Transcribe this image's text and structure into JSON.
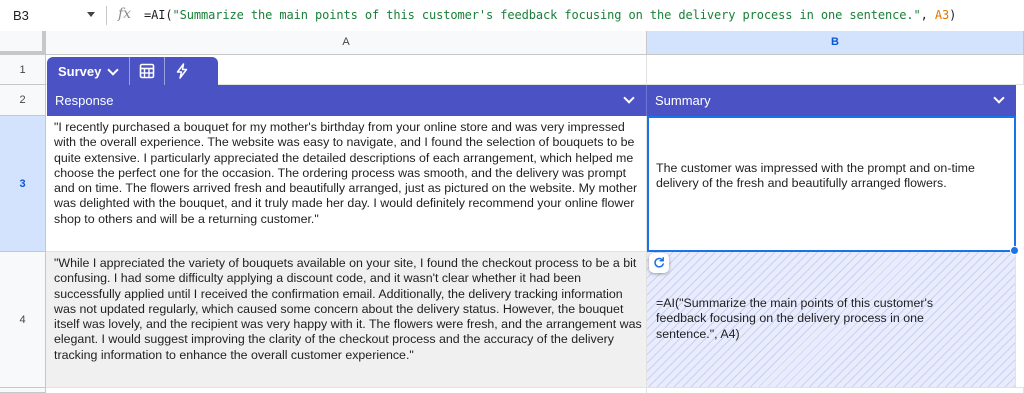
{
  "formula_bar": {
    "name_box": "B3",
    "fx_label": "fx",
    "formula_prefix": "=AI(",
    "formula_string": "\"Summarize the main points of this customer's feedback focusing on the delivery process in one sentence.\"",
    "formula_sep": ", ",
    "formula_ref": "A3",
    "formula_suffix": ")"
  },
  "columns": [
    "A",
    "B"
  ],
  "rows": [
    "1",
    "2",
    "3",
    "4"
  ],
  "table": {
    "name": "Survey",
    "headers": [
      "Response",
      "Summary"
    ]
  },
  "cells": {
    "A3": "\"I recently purchased a bouquet for my mother's birthday from your online store and was very impressed with the overall experience. The website was easy to navigate, and I found the selection of bouquets to be quite extensive. I particularly appreciated the detailed descriptions of each arrangement, which helped me choose the perfect one for the occasion. The ordering process was smooth, and the delivery was prompt and on time. The flowers arrived fresh and beautifully arranged, just as pictured on the website. My mother was delighted with the bouquet, and it truly made her day. I would definitely recommend your online flower shop to others and will be a returning customer.\"",
    "B3": "The customer was impressed with the prompt and on-time delivery of the fresh and beautifully arranged flowers.",
    "A4": "\"While I appreciated the variety of bouquets available on your site, I found the checkout process to be a bit confusing. I had some difficulty applying a discount code, and it wasn't clear whether it had been successfully applied until I received the confirmation email. Additionally, the delivery tracking information was not updated regularly, which caused some concern about the delivery status. However, the bouquet itself was lovely, and the recipient was very happy with it. The flowers were fresh, and the arrangement was elegant. I would suggest improving the clarity of the checkout process and the accuracy of the delivery tracking information to enhance the overall customer experience.\"",
    "B4": "=AI(\"Summarize the main points of this customer's feedback focusing on the delivery process in one sentence.\", A4)"
  },
  "colors": {
    "table_header": "#4a52c4",
    "selection": "#1a73e8",
    "selected_header_bg": "#d3e3fd",
    "string_literal": "#188038",
    "cell_ref": "#e37400"
  },
  "icons": [
    "chevron-down-icon",
    "table-grid-icon",
    "lightning-icon",
    "refresh-icon"
  ]
}
